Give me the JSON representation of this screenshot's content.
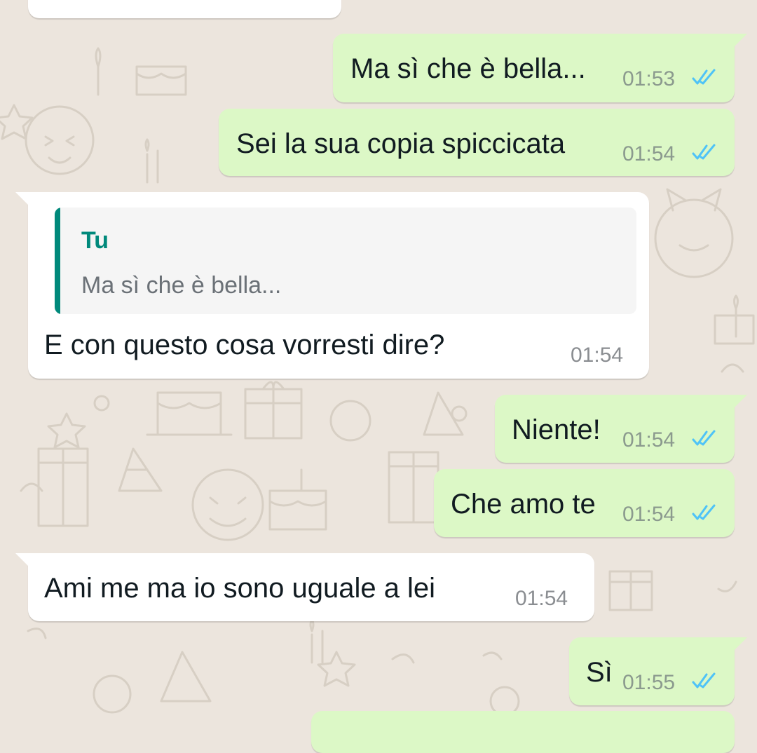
{
  "chat": {
    "messages": [
      {
        "text": "Ma sì che è bella...",
        "time": "01:53"
      },
      {
        "text": "Sei la sua copia spiccicata",
        "time": "01:54"
      },
      {
        "reply_author": "Tu",
        "reply_text": "Ma sì che è bella...",
        "text": "E con questo cosa vorresti dire?",
        "time": "01:54"
      },
      {
        "text": "Niente!",
        "time": "01:54"
      },
      {
        "text": "Che amo te",
        "time": "01:54"
      },
      {
        "text": "Ami me ma io sono uguale a lei",
        "time": "01:54"
      },
      {
        "text": "Sì",
        "time": "01:55"
      }
    ]
  },
  "colors": {
    "background": "#ece5dd",
    "outgoing_bubble": "#dcf8c6",
    "incoming_bubble": "#ffffff",
    "read_ticks": "#4fc3f7",
    "quote_accent": "#00897b"
  },
  "icons": {
    "read_receipt": "double-check-icon"
  }
}
